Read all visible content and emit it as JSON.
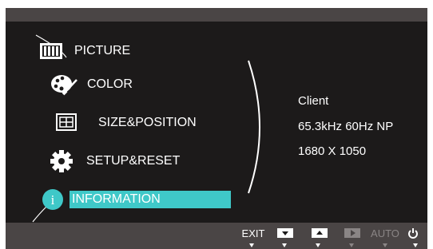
{
  "menu": {
    "items": [
      {
        "label": "PICTURE",
        "icon": "picture-icon"
      },
      {
        "label": "COLOR",
        "icon": "palette-icon"
      },
      {
        "label": "SIZE&POSITION",
        "icon": "size-position-icon"
      },
      {
        "label": "SETUP&RESET",
        "icon": "gear-icon"
      },
      {
        "label": "INFORMATION",
        "icon": "info-icon",
        "selected": true
      }
    ]
  },
  "info": {
    "line1": "Client",
    "line2": "65.3kHz 60Hz NP",
    "line3": "1680 X 1050"
  },
  "controls": {
    "exit_label": "EXIT",
    "auto_label": "AUTO",
    "power_icon": "power-icon"
  },
  "colors": {
    "background": "#1c1a1a",
    "bar": "#4a4545",
    "highlight": "#3fc8c8",
    "text": "#ffffff",
    "disabled": "#8a8585"
  }
}
